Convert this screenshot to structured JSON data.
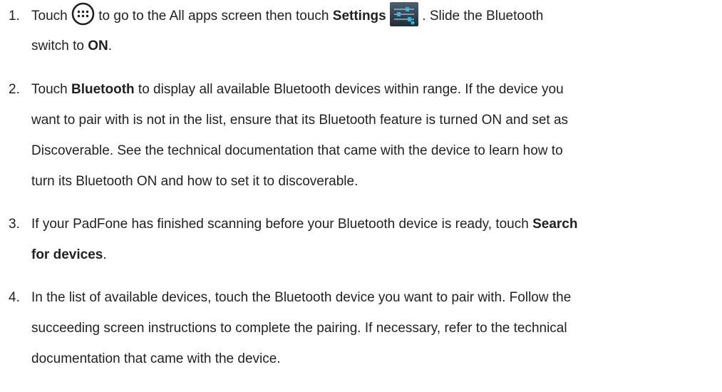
{
  "steps": [
    {
      "number": "1.",
      "part1": "Touch ",
      "part2": " to go to the All apps screen then touch ",
      "bold1": "Settings",
      "part3": " . Slide the Bluetooth",
      "part4": "switch to ",
      "bold2": "ON",
      "part5": "."
    },
    {
      "number": "2.",
      "part1": "Touch ",
      "bold1": "Bluetooth",
      "part2": " to display all available Bluetooth devices within range. If the device you",
      "line2": "want to pair with is not in the list, ensure that its Bluetooth feature is turned ON and set as",
      "line3": "Discoverable. See the technical documentation that came with the device to learn how to",
      "line4": "turn its Bluetooth ON and how to set it to discoverable."
    },
    {
      "number": "3.",
      "part1": "If your PadFone has finished scanning before your Bluetooth device is ready, touch ",
      "bold1": "Search",
      "bold2": "for devices",
      "part2": "."
    },
    {
      "number": "4.",
      "line1": "In the list of available devices, touch the Bluetooth device you want to pair with. Follow the",
      "line2": "succeeding screen instructions to complete the pairing. If necessary, refer to the technical",
      "line3": "documentation that came with the device."
    }
  ],
  "icons": {
    "apps": "all-apps-icon",
    "settings": "settings-icon"
  },
  "colors": {
    "text": "#231f20",
    "settings_icon_bg": "#2c3e4c",
    "settings_slider": "#33b5e5"
  }
}
